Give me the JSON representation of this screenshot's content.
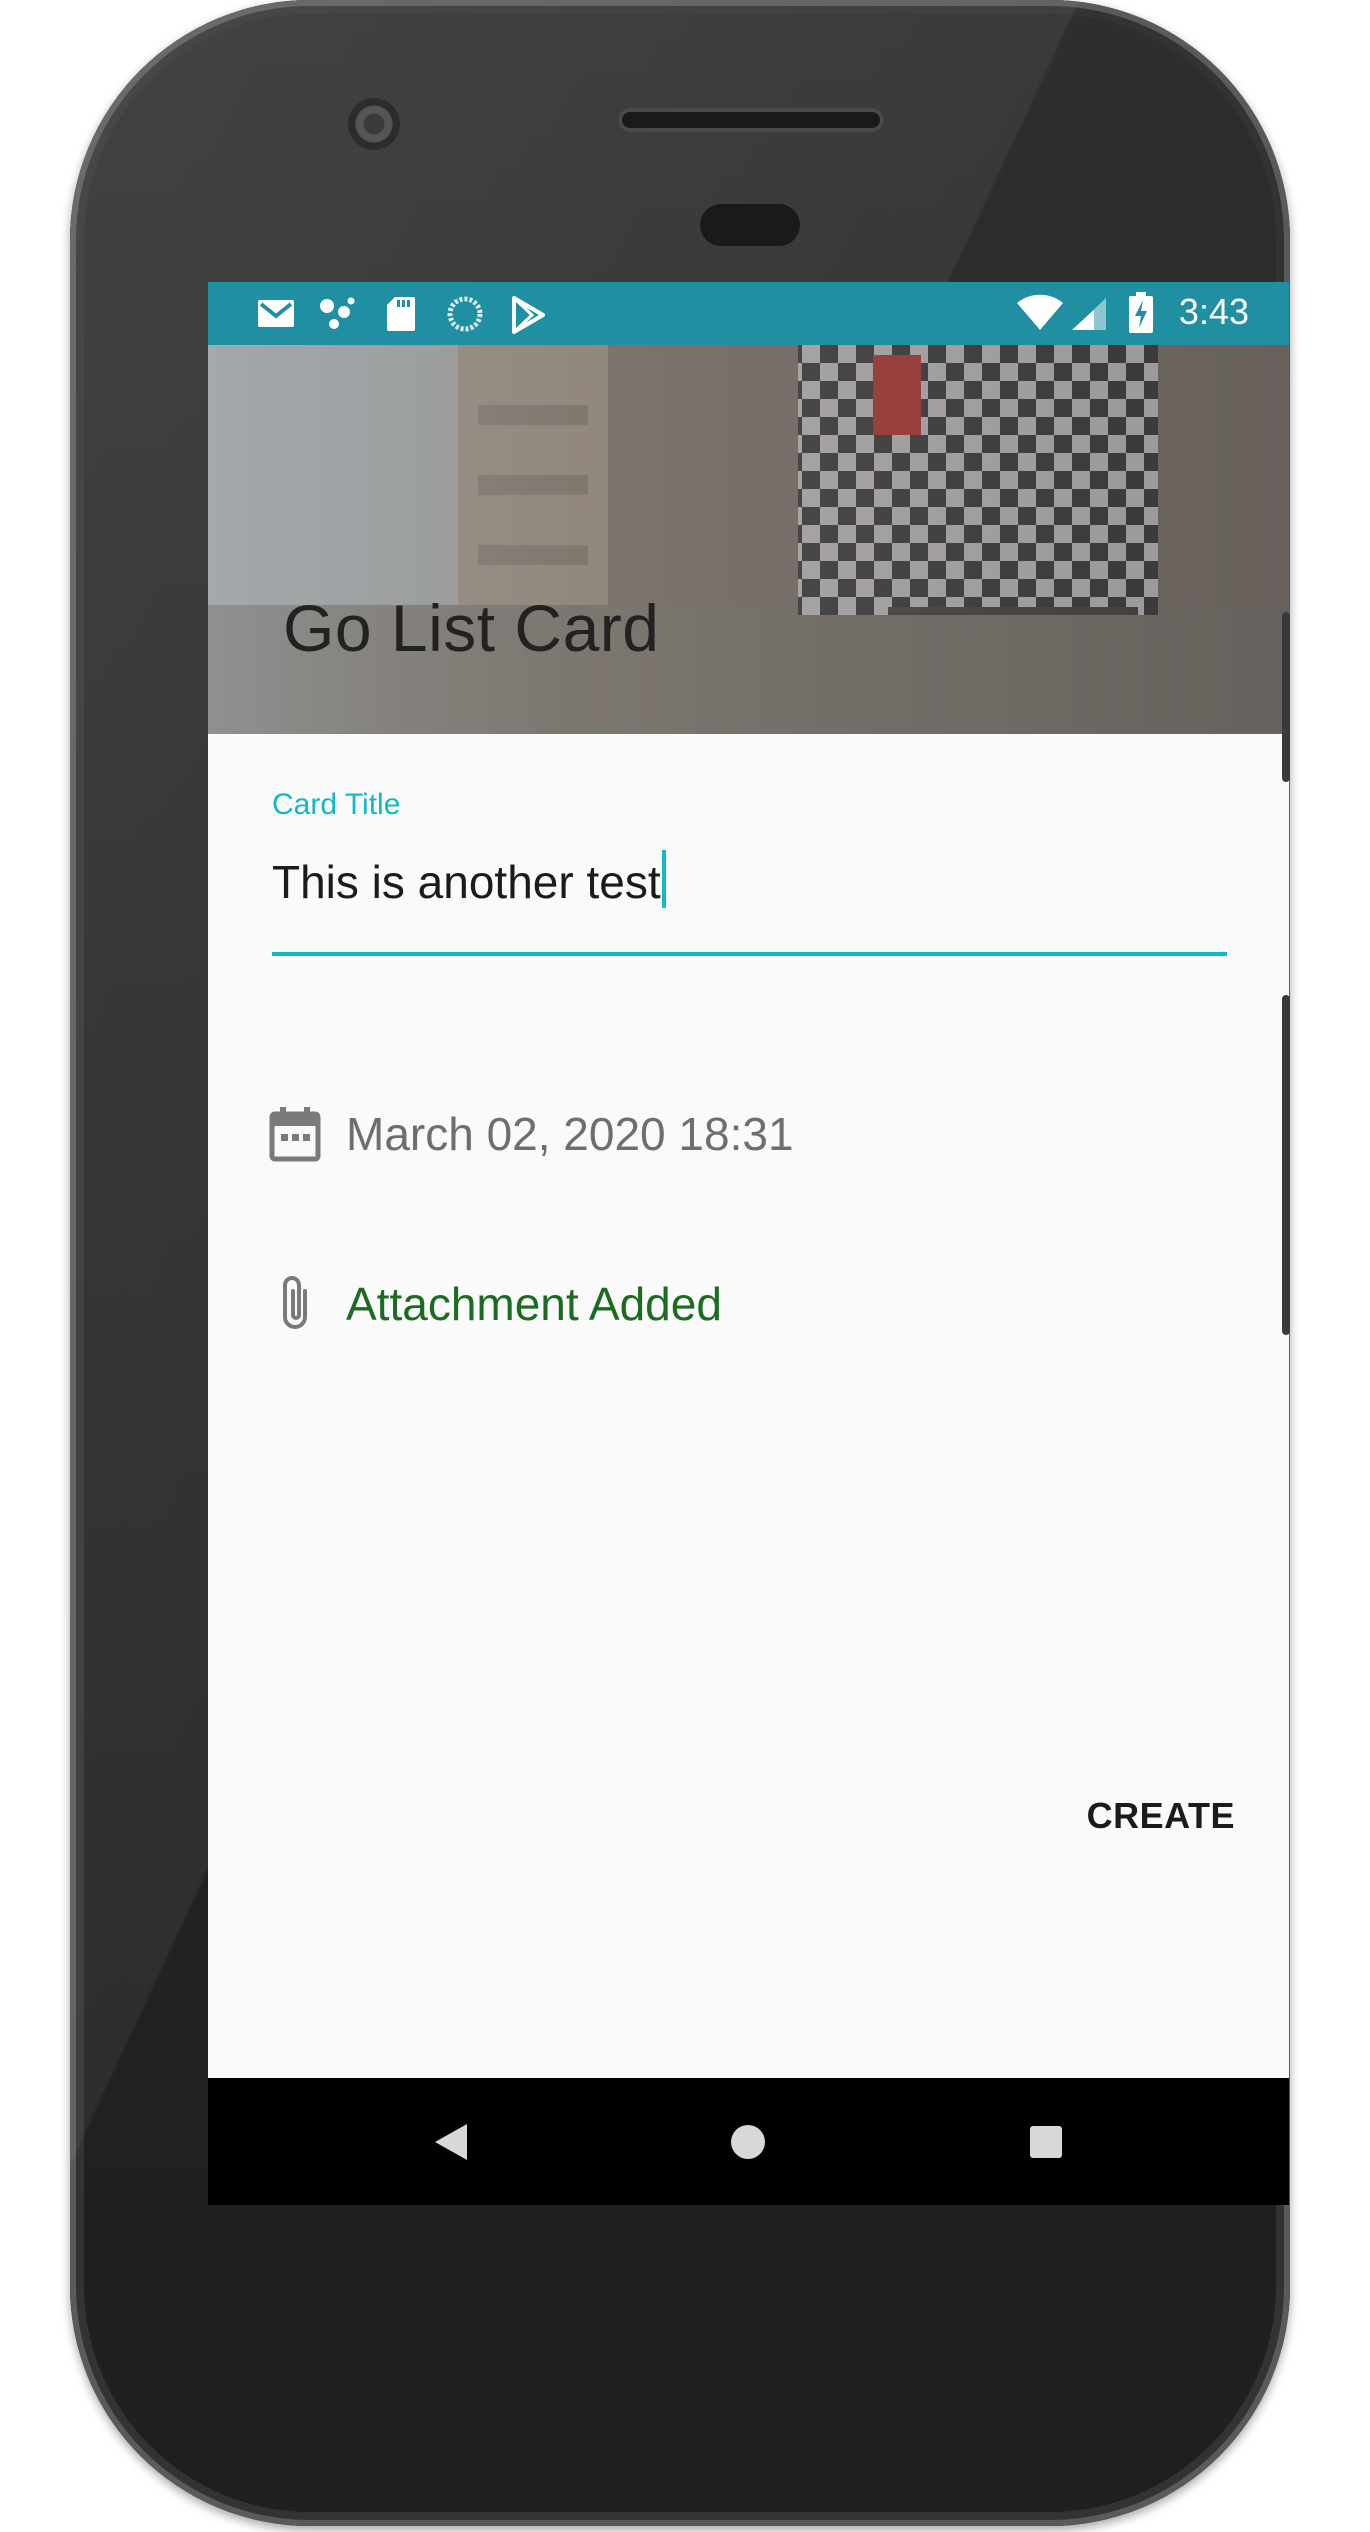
{
  "status_bar": {
    "time": "3:43",
    "left_icons": [
      "gmail-icon",
      "assistant-icon",
      "sd-card-icon",
      "sync-icon",
      "play-store-icon"
    ],
    "right_icons": [
      "wifi-icon",
      "signal-icon",
      "battery-charging-icon"
    ],
    "background": "#1f8fa1"
  },
  "header": {
    "title": "Go List Card"
  },
  "form": {
    "title_field": {
      "label": "Card Title",
      "value": "This is another test",
      "accent": "#14b8c3"
    },
    "date_row": {
      "icon": "calendar-icon",
      "text": "March 02, 2020 18:31"
    },
    "attachment_row": {
      "icon": "paperclip-icon",
      "text": "Attachment Added",
      "color": "#1b6b20"
    },
    "create_button": {
      "label": "CREATE"
    }
  },
  "navigation_bar": {
    "buttons": [
      "back-icon",
      "home-icon",
      "recents-icon"
    ]
  }
}
